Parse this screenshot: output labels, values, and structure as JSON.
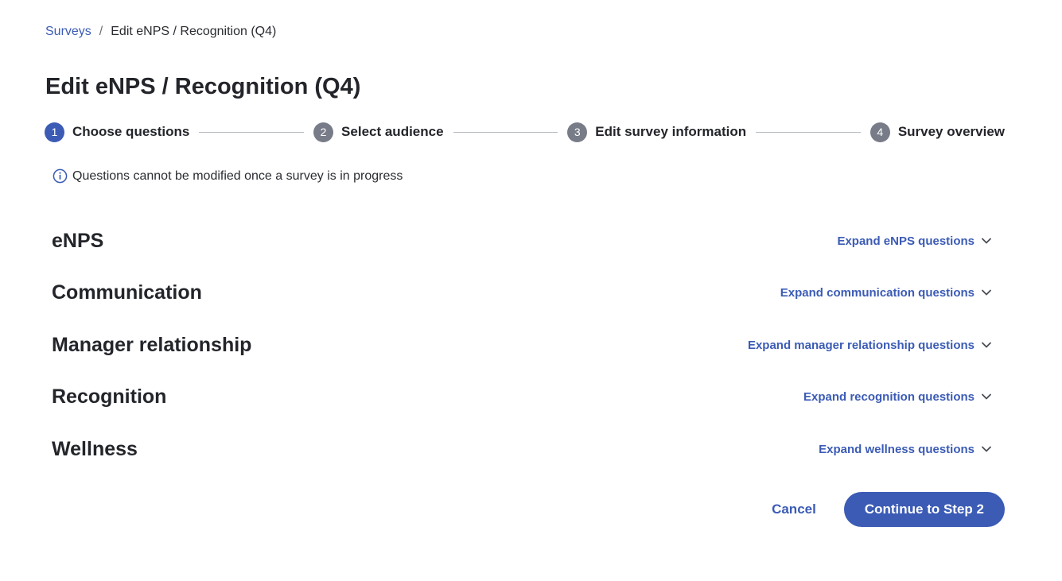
{
  "breadcrumb": {
    "root": "Surveys",
    "separator": "/",
    "current": "Edit eNPS / Recognition (Q4)"
  },
  "page_title": "Edit eNPS / Recognition (Q4)",
  "stepper": {
    "steps": [
      {
        "number": "1",
        "label": "Choose questions",
        "state": "active"
      },
      {
        "number": "2",
        "label": "Select audience",
        "state": "inactive"
      },
      {
        "number": "3",
        "label": "Edit survey information",
        "state": "inactive"
      },
      {
        "number": "4",
        "label": "Survey overview",
        "state": "inactive"
      }
    ]
  },
  "notice": {
    "icon": "info-icon",
    "text": "Questions cannot be modified once a survey is in progress"
  },
  "categories": [
    {
      "title": "eNPS",
      "expand_label": "Expand eNPS questions"
    },
    {
      "title": "Communication",
      "expand_label": "Expand communication questions"
    },
    {
      "title": "Manager relationship",
      "expand_label": "Expand manager relationship questions"
    },
    {
      "title": "Recognition",
      "expand_label": "Expand recognition questions"
    },
    {
      "title": "Wellness",
      "expand_label": "Expand wellness questions"
    }
  ],
  "actions": {
    "cancel_label": "Cancel",
    "continue_label": "Continue to Step 2"
  },
  "colors": {
    "accent": "#3b5bb5",
    "inactive_step": "#787c88",
    "text": "#23252a"
  }
}
